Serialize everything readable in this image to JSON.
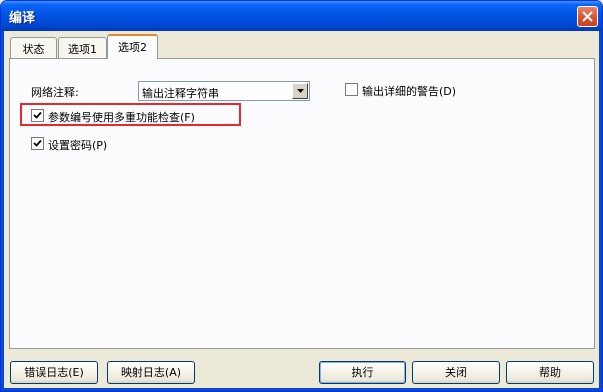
{
  "window": {
    "title": "编译"
  },
  "tabs": [
    {
      "label": "状态"
    },
    {
      "label": "选项1"
    },
    {
      "label": "选项2"
    }
  ],
  "options2": {
    "network_comment_label": "网络注释:",
    "network_comment_value": "输出注释字符串",
    "detailed_warning_label": "输出详细的警告(D)",
    "detailed_warning_checked": false,
    "param_multi_check_label": "参数编号使用多重功能检查(F)",
    "param_multi_check_checked": true,
    "set_password_label": "设置密码(P)",
    "set_password_checked": true
  },
  "footer": {
    "error_log": "错误日志(E)",
    "mapping_log": "映射日志(A)",
    "execute": "执行",
    "close": "关闭",
    "help": "帮助"
  },
  "colors": {
    "titlebar": "#0054e3",
    "highlight": "#e8292b",
    "active_tab_accent": "#e68b2c"
  }
}
